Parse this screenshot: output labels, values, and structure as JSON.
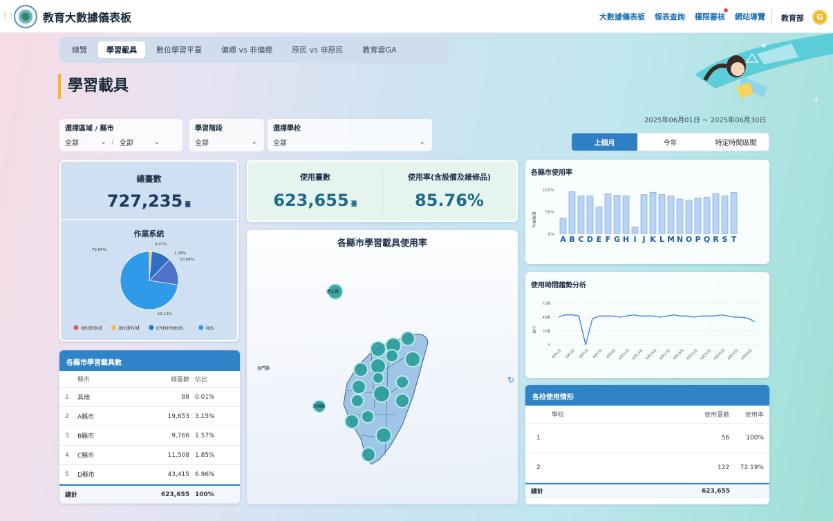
{
  "app": {
    "title": "教育大數據儀表板"
  },
  "topnav": {
    "items": [
      "大數據儀表板",
      "報表查詢",
      "權限審核",
      "網站導覽"
    ],
    "user": "教育部",
    "coin": "G"
  },
  "tabs": {
    "items": [
      "總覽",
      "學習載具",
      "數位學習平臺",
      "偏鄉 vs 非偏鄉",
      "原民 vs 非原民",
      "教育雲GA"
    ],
    "active": "學習載具"
  },
  "page": {
    "title": "學習載具"
  },
  "filters": {
    "region": {
      "label": "選擇區域 / 縣市",
      "value1": "全部",
      "separator": "/",
      "value2": "全部"
    },
    "stage": {
      "label": "學習階段",
      "value": "全部"
    },
    "school": {
      "label": "選擇學校",
      "value": "全部"
    }
  },
  "date_range": "2025年06月01日 ~ 2025年06月30日",
  "period": {
    "options": [
      "上個月",
      "今年",
      "特定時間區間"
    ],
    "active": "上個月"
  },
  "total": {
    "label": "總臺數",
    "value": "727,235",
    "unit": "臺",
    "os_label": "作業系統"
  },
  "usage": {
    "count_label": "使用臺數",
    "count_value": "623,655",
    "count_unit": "臺",
    "rate_label": "使用率(含設備及維修品)",
    "rate_value": "85.76%"
  },
  "map": {
    "title": "各縣市學習載具使用率",
    "labels": {
      "top": "連江縣",
      "left": "金門縣",
      "penghu": "澎湖縣"
    }
  },
  "county_table": {
    "title": "各縣市學習載具數",
    "headers": [
      "縣市",
      "總臺數",
      "佔比"
    ],
    "rows": [
      {
        "idx": "1",
        "name": "其他",
        "count": "88",
        "pct": "0.01%"
      },
      {
        "idx": "2",
        "name": "A縣市",
        "count": "19,653",
        "pct": "3.15%"
      },
      {
        "idx": "3",
        "name": "B縣市",
        "count": "9,766",
        "pct": "1.57%"
      },
      {
        "idx": "4",
        "name": "C縣市",
        "count": "11,508",
        "pct": "1.85%"
      },
      {
        "idx": "5",
        "name": "D縣市",
        "count": "43,415",
        "pct": "6.96%"
      }
    ],
    "total": {
      "label": "總計",
      "count": "623,655",
      "pct": "100%"
    }
  },
  "school_table": {
    "title": "各校使用情形",
    "headers": [
      "學校",
      "使用臺數",
      "使用率"
    ],
    "rows": [
      {
        "name": "1",
        "count": "56",
        "rate": "100%"
      },
      {
        "name": "2",
        "count": "122",
        "rate": "72.19%"
      }
    ],
    "total": {
      "label": "總計",
      "count": "623,655"
    }
  },
  "chart_data": [
    {
      "type": "pie",
      "title": "作業系統",
      "labels": [
        "android",
        "android",
        "chromeos",
        "ios"
      ],
      "values": [
        0.07,
        1.26,
        10.98,
        72.64
      ],
      "slice_labels": [
        "0.07%",
        "1.26%",
        "10.98%",
        "72.64%",
        "15.12%"
      ],
      "colors": [
        "#e05b5b",
        "#f2c230",
        "#2f6fc4",
        "#2f9be8"
      ],
      "legend_position": "bottom"
    },
    {
      "type": "bar",
      "title": "各縣市使用率",
      "categories": [
        "A",
        "B",
        "C",
        "D",
        "E",
        "F",
        "G",
        "H",
        "I",
        "J",
        "K",
        "L",
        "M",
        "N",
        "O",
        "P",
        "Q",
        "R",
        "S",
        "T"
      ],
      "values": [
        35,
        95,
        85,
        85,
        60,
        90,
        87,
        85,
        15,
        88,
        93,
        88,
        85,
        78,
        75,
        80,
        82,
        90,
        85,
        93
      ],
      "ylabel": "使用率%",
      "yticks": [
        "100%",
        "50%",
        "0%"
      ],
      "ylim": [
        0,
        100
      ]
    },
    {
      "type": "line",
      "title": "使用時間趨勢分析",
      "ylabel": "小時",
      "yticks": [
        "72萬",
        "48萬",
        "24萬",
        "0"
      ],
      "ylim": [
        0,
        72
      ],
      "x": [
        "6月1日",
        "6月3日",
        "6月5日",
        "6月7日",
        "6月9日",
        "6月11日",
        "6月13日",
        "6月15日",
        "6月17日",
        "6月19日",
        "6月21日",
        "6月23日",
        "6月25日",
        "6月27日",
        "6月29日"
      ],
      "values": [
        48,
        52,
        52,
        50,
        0,
        45,
        50,
        50,
        50,
        48,
        50,
        52,
        50,
        50,
        50,
        48,
        50,
        52,
        50,
        50,
        48,
        50,
        50,
        50,
        52,
        50,
        48,
        48,
        46,
        40
      ]
    }
  ]
}
